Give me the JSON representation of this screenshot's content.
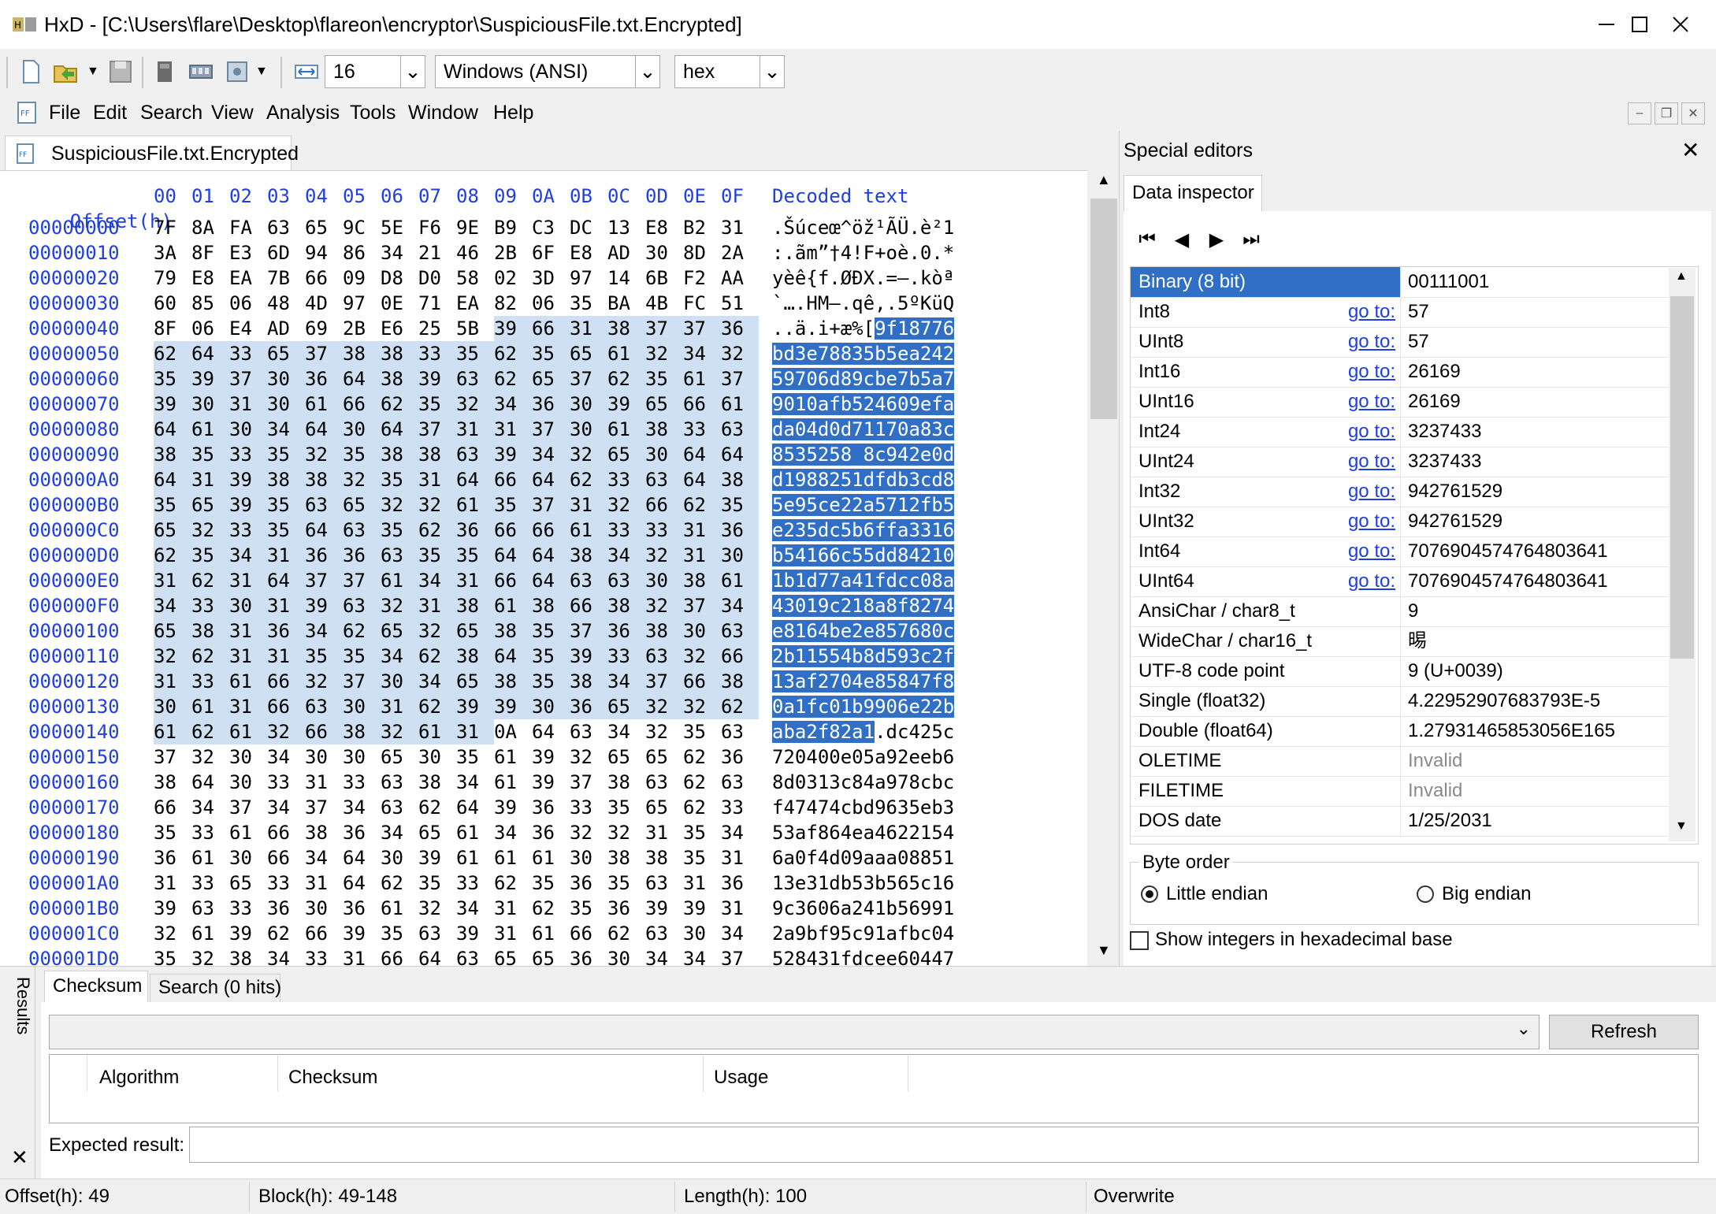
{
  "window": {
    "title": "HxD - [C:\\Users\\flare\\Desktop\\flareon\\encryptor\\SuspiciousFile.txt.Encrypted]",
    "minimize_icon": "minimize-icon",
    "maximize_icon": "maximize-icon",
    "close_icon": "close-icon"
  },
  "toolbar": {
    "bytes_per_row": "16",
    "charset": "Windows (ANSI)",
    "display_mode": "hex",
    "icons": [
      "new-file-icon",
      "open-file-icon",
      "save-icon",
      "disk-icon",
      "ram-icon",
      "save-as-icon",
      "bytes-per-row-icon"
    ]
  },
  "menu": {
    "items": [
      "File",
      "Edit",
      "Search",
      "View",
      "Analysis",
      "Tools",
      "Window",
      "Help"
    ]
  },
  "document": {
    "tab_label": "SuspiciousFile.txt.Encrypted",
    "header": {
      "offset_label": "Offset(h)",
      "columns": [
        "00",
        "01",
        "02",
        "03",
        "04",
        "05",
        "06",
        "07",
        "08",
        "09",
        "0A",
        "0B",
        "0C",
        "0D",
        "0E",
        "0F"
      ],
      "decoded_label": "Decoded text"
    },
    "rows": [
      {
        "offset": "00000000",
        "bytes": [
          "7F",
          "8A",
          "FA",
          "63",
          "65",
          "9C",
          "5E",
          "F6",
          "9E",
          "B9",
          "C3",
          "DC",
          "13",
          "E8",
          "B2",
          "31"
        ],
        "text": ".Šúceœ^öž¹ÃÜ.è²1"
      },
      {
        "offset": "00000010",
        "bytes": [
          "3A",
          "8F",
          "E3",
          "6D",
          "94",
          "86",
          "34",
          "21",
          "46",
          "2B",
          "6F",
          "E8",
          "AD",
          "30",
          "8D",
          "2A"
        ],
        "text": ":.ãm”†4!F+oè.0.*"
      },
      {
        "offset": "00000020",
        "bytes": [
          "79",
          "E8",
          "EA",
          "7B",
          "66",
          "09",
          "D8",
          "D0",
          "58",
          "02",
          "3D",
          "97",
          "14",
          "6B",
          "F2",
          "AA"
        ],
        "text": "yèê{f.ØÐX.=—.kòª"
      },
      {
        "offset": "00000030",
        "bytes": [
          "60",
          "85",
          "06",
          "48",
          "4D",
          "97",
          "0E",
          "71",
          "EA",
          "82",
          "06",
          "35",
          "BA",
          "4B",
          "FC",
          "51"
        ],
        "text": "`….HM—.qê‚.5ºKüQ"
      },
      {
        "offset": "00000040",
        "bytes": [
          "8F",
          "06",
          "E4",
          "AD",
          "69",
          "2B",
          "E6",
          "25",
          "5B",
          "39",
          "66",
          "31",
          "38",
          "37",
          "37",
          "36"
        ],
        "text": "..ä.i+æ%[9f18776"
      },
      {
        "offset": "00000050",
        "bytes": [
          "62",
          "64",
          "33",
          "65",
          "37",
          "38",
          "38",
          "33",
          "35",
          "62",
          "35",
          "65",
          "61",
          "32",
          "34",
          "32"
        ],
        "text": "bd3e78835b5ea242"
      },
      {
        "offset": "00000060",
        "bytes": [
          "35",
          "39",
          "37",
          "30",
          "36",
          "64",
          "38",
          "39",
          "63",
          "62",
          "65",
          "37",
          "62",
          "35",
          "61",
          "37"
        ],
        "text": "59706d89cbe7b5a7"
      },
      {
        "offset": "00000070",
        "bytes": [
          "39",
          "30",
          "31",
          "30",
          "61",
          "66",
          "62",
          "35",
          "32",
          "34",
          "36",
          "30",
          "39",
          "65",
          "66",
          "61"
        ],
        "text": "9010afb524609efa"
      },
      {
        "offset": "00000080",
        "bytes": [
          "64",
          "61",
          "30",
          "34",
          "64",
          "30",
          "64",
          "37",
          "31",
          "31",
          "37",
          "30",
          "61",
          "38",
          "33",
          "63"
        ],
        "text": "da04d0d71170a83c"
      },
      {
        "offset": "00000090",
        "bytes": [
          "38",
          "35",
          "33",
          "35",
          "32",
          "35",
          "38",
          "38",
          "63",
          "39",
          "34",
          "32",
          "65",
          "30",
          "64",
          "64"
        ],
        "text": "8535258 8c942e0d"
      },
      {
        "offset": "000000A0",
        "bytes": [
          "64",
          "31",
          "39",
          "38",
          "38",
          "32",
          "35",
          "31",
          "64",
          "66",
          "64",
          "62",
          "33",
          "63",
          "64",
          "38"
        ],
        "text": "d1988251dfdb3cd8"
      },
      {
        "offset": "000000B0",
        "bytes": [
          "35",
          "65",
          "39",
          "35",
          "63",
          "65",
          "32",
          "32",
          "61",
          "35",
          "37",
          "31",
          "32",
          "66",
          "62",
          "35"
        ],
        "text": "5e95ce22a5712fb5"
      },
      {
        "offset": "000000C0",
        "bytes": [
          "65",
          "32",
          "33",
          "35",
          "64",
          "63",
          "35",
          "62",
          "36",
          "66",
          "66",
          "61",
          "33",
          "33",
          "31",
          "36"
        ],
        "text": "e235dc5b6ffa3316"
      },
      {
        "offset": "000000D0",
        "bytes": [
          "62",
          "35",
          "34",
          "31",
          "36",
          "36",
          "63",
          "35",
          "35",
          "64",
          "64",
          "38",
          "34",
          "32",
          "31",
          "30"
        ],
        "text": "b54166c55dd84210"
      },
      {
        "offset": "000000E0",
        "bytes": [
          "31",
          "62",
          "31",
          "64",
          "37",
          "37",
          "61",
          "34",
          "31",
          "66",
          "64",
          "63",
          "63",
          "30",
          "38",
          "61"
        ],
        "text": "1b1d77a41fdcc08a"
      },
      {
        "offset": "000000F0",
        "bytes": [
          "34",
          "33",
          "30",
          "31",
          "39",
          "63",
          "32",
          "31",
          "38",
          "61",
          "38",
          "66",
          "38",
          "32",
          "37",
          "34"
        ],
        "text": "43019c218a8f8274"
      },
      {
        "offset": "00000100",
        "bytes": [
          "65",
          "38",
          "31",
          "36",
          "34",
          "62",
          "65",
          "32",
          "65",
          "38",
          "35",
          "37",
          "36",
          "38",
          "30",
          "63"
        ],
        "text": "e8164be2e857680c"
      },
      {
        "offset": "00000110",
        "bytes": [
          "32",
          "62",
          "31",
          "31",
          "35",
          "35",
          "34",
          "62",
          "38",
          "64",
          "35",
          "39",
          "33",
          "63",
          "32",
          "66"
        ],
        "text": "2b11554b8d593c2f"
      },
      {
        "offset": "00000120",
        "bytes": [
          "31",
          "33",
          "61",
          "66",
          "32",
          "37",
          "30",
          "34",
          "65",
          "38",
          "35",
          "38",
          "34",
          "37",
          "66",
          "38"
        ],
        "text": "13af2704e85847f8"
      },
      {
        "offset": "00000130",
        "bytes": [
          "30",
          "61",
          "31",
          "66",
          "63",
          "30",
          "31",
          "62",
          "39",
          "39",
          "30",
          "36",
          "65",
          "32",
          "32",
          "62"
        ],
        "text": "0a1fc01b9906e22b"
      },
      {
        "offset": "00000140",
        "bytes": [
          "61",
          "62",
          "61",
          "32",
          "66",
          "38",
          "32",
          "61",
          "31",
          "0A",
          "64",
          "63",
          "34",
          "32",
          "35",
          "63"
        ],
        "text": "aba2f82a1.dc425c"
      },
      {
        "offset": "00000150",
        "bytes": [
          "37",
          "32",
          "30",
          "34",
          "30",
          "30",
          "65",
          "30",
          "35",
          "61",
          "39",
          "32",
          "65",
          "65",
          "62",
          "36"
        ],
        "text": "720400e05a92eeb6"
      },
      {
        "offset": "00000160",
        "bytes": [
          "38",
          "64",
          "30",
          "33",
          "31",
          "33",
          "63",
          "38",
          "34",
          "61",
          "39",
          "37",
          "38",
          "63",
          "62",
          "63"
        ],
        "text": "8d0313c84a978cbc"
      },
      {
        "offset": "00000170",
        "bytes": [
          "66",
          "34",
          "37",
          "34",
          "37",
          "34",
          "63",
          "62",
          "64",
          "39",
          "36",
          "33",
          "35",
          "65",
          "62",
          "33"
        ],
        "text": "f47474cbd9635eb3"
      },
      {
        "offset": "00000180",
        "bytes": [
          "35",
          "33",
          "61",
          "66",
          "38",
          "36",
          "34",
          "65",
          "61",
          "34",
          "36",
          "32",
          "32",
          "31",
          "35",
          "34"
        ],
        "text": "53af864ea4622154"
      },
      {
        "offset": "00000190",
        "bytes": [
          "36",
          "61",
          "30",
          "66",
          "34",
          "64",
          "30",
          "39",
          "61",
          "61",
          "61",
          "30",
          "38",
          "38",
          "35",
          "31"
        ],
        "text": "6a0f4d09aaa08851"
      },
      {
        "offset": "000001A0",
        "bytes": [
          "31",
          "33",
          "65",
          "33",
          "31",
          "64",
          "62",
          "35",
          "33",
          "62",
          "35",
          "36",
          "35",
          "63",
          "31",
          "36"
        ],
        "text": "13e31db53b565c16"
      },
      {
        "offset": "000001B0",
        "bytes": [
          "39",
          "63",
          "33",
          "36",
          "30",
          "36",
          "61",
          "32",
          "34",
          "31",
          "62",
          "35",
          "36",
          "39",
          "39",
          "31"
        ],
        "text": "9c3606a241b56991"
      },
      {
        "offset": "000001C0",
        "bytes": [
          "32",
          "61",
          "39",
          "62",
          "66",
          "39",
          "35",
          "63",
          "39",
          "31",
          "61",
          "66",
          "62",
          "63",
          "30",
          "34"
        ],
        "text": "2a9bf95c91afbc04"
      },
      {
        "offset": "000001D0",
        "bytes": [
          "35",
          "32",
          "38",
          "34",
          "33",
          "31",
          "66",
          "64",
          "63",
          "65",
          "65",
          "36",
          "30",
          "34",
          "34",
          "37"
        ],
        "text": "528431fdcee60447"
      }
    ],
    "selection_start": 73,
    "selection_end": 328
  },
  "special_editors": {
    "title": "Special editors",
    "close_icon": "close-icon",
    "tab_label": "Data inspector",
    "nav_icons": [
      "first-icon",
      "prev-icon",
      "next-icon",
      "last-icon"
    ],
    "inspector": [
      {
        "name": "Binary (8 bit)",
        "goto": "",
        "value": "00111001",
        "selected": true
      },
      {
        "name": "Int8",
        "goto": "go to:",
        "value": "57"
      },
      {
        "name": "UInt8",
        "goto": "go to:",
        "value": "57"
      },
      {
        "name": "Int16",
        "goto": "go to:",
        "value": "26169"
      },
      {
        "name": "UInt16",
        "goto": "go to:",
        "value": "26169"
      },
      {
        "name": "Int24",
        "goto": "go to:",
        "value": "3237433"
      },
      {
        "name": "UInt24",
        "goto": "go to:",
        "value": "3237433"
      },
      {
        "name": "Int32",
        "goto": "go to:",
        "value": "942761529"
      },
      {
        "name": "UInt32",
        "goto": "go to:",
        "value": "942761529"
      },
      {
        "name": "Int64",
        "goto": "go to:",
        "value": "7076904574764803641"
      },
      {
        "name": "UInt64",
        "goto": "go to:",
        "value": "7076904574764803641"
      },
      {
        "name": "AnsiChar / char8_t",
        "goto": "",
        "value": "9"
      },
      {
        "name": "WideChar / char16_t",
        "goto": "",
        "value": "晹"
      },
      {
        "name": "UTF-8 code point",
        "goto": "",
        "value": "9 (U+0039)"
      },
      {
        "name": "Single (float32)",
        "goto": "",
        "value": "4.22952907683793E-5"
      },
      {
        "name": "Double (float64)",
        "goto": "",
        "value": "1.27931465853056E165"
      },
      {
        "name": "OLETIME",
        "goto": "",
        "value": "Invalid",
        "muted": true
      },
      {
        "name": "FILETIME",
        "goto": "",
        "value": "Invalid",
        "muted": true
      },
      {
        "name": "DOS date",
        "goto": "",
        "value": "1/25/2031"
      }
    ],
    "byte_order": {
      "label": "Byte order",
      "little": "Little endian",
      "big": "Big endian",
      "selected": "little"
    },
    "show_hex_label": "Show integers in hexadecimal base"
  },
  "results": {
    "side_label": "Results",
    "close_icon": "close-icon",
    "tabs": [
      "Checksum",
      "Search (0 hits)"
    ],
    "refresh_label": "Refresh",
    "columns": [
      "Algorithm",
      "Checksum",
      "Usage"
    ],
    "expected_label": "Expected result:",
    "expected_value": ""
  },
  "status": {
    "offset": "Offset(h): 49",
    "block": "Block(h): 49-148",
    "length": "Length(h): 100",
    "mode": "Overwrite"
  }
}
